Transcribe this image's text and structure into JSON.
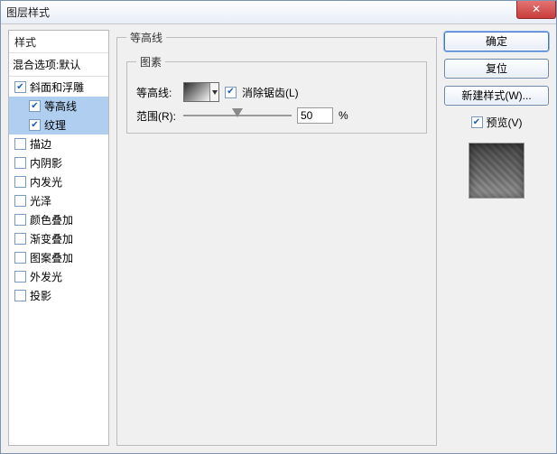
{
  "window": {
    "title": "图层样式"
  },
  "close_label": "✕",
  "styles": {
    "header": "样式",
    "blend_options": "混合选项:默认",
    "items": [
      {
        "label": "斜面和浮雕",
        "checked": true,
        "selected": false,
        "sub": false
      },
      {
        "label": "等高线",
        "checked": true,
        "selected": true,
        "sub": true
      },
      {
        "label": "纹理",
        "checked": true,
        "selected": true,
        "sub": true
      },
      {
        "label": "描边",
        "checked": false,
        "selected": false,
        "sub": false
      },
      {
        "label": "内阴影",
        "checked": false,
        "selected": false,
        "sub": false
      },
      {
        "label": "内发光",
        "checked": false,
        "selected": false,
        "sub": false
      },
      {
        "label": "光泽",
        "checked": false,
        "selected": false,
        "sub": false
      },
      {
        "label": "颜色叠加",
        "checked": false,
        "selected": false,
        "sub": false
      },
      {
        "label": "渐变叠加",
        "checked": false,
        "selected": false,
        "sub": false
      },
      {
        "label": "图案叠加",
        "checked": false,
        "selected": false,
        "sub": false
      },
      {
        "label": "外发光",
        "checked": false,
        "selected": false,
        "sub": false
      },
      {
        "label": "投影",
        "checked": false,
        "selected": false,
        "sub": false
      }
    ]
  },
  "center": {
    "group_title": "等高线",
    "elements_title": "图素",
    "contour_label": "等高线:",
    "antialias_label": "消除锯齿(L)",
    "antialias_checked": true,
    "range_label": "范围(R):",
    "range_value": "50",
    "range_unit": "%"
  },
  "right": {
    "ok": "确定",
    "reset": "复位",
    "new_style": "新建样式(W)...",
    "preview_label": "预览(V)",
    "preview_checked": true
  }
}
